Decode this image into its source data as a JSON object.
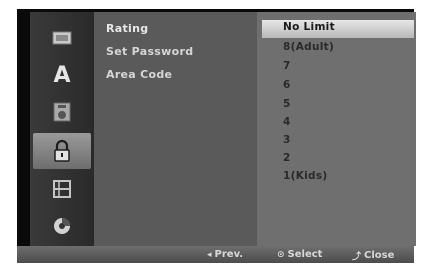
{
  "sidebar": {
    "icons": [
      {
        "name": "disc-icon",
        "glyph": "▭"
      },
      {
        "name": "language-icon",
        "glyph": "A"
      },
      {
        "name": "audio-icon",
        "glyph": "♫"
      },
      {
        "name": "lock-icon",
        "glyph": "🔒"
      },
      {
        "name": "film-icon",
        "glyph": "▦"
      },
      {
        "name": "other-icon",
        "glyph": "●"
      }
    ]
  },
  "menu": {
    "items": [
      "Rating",
      "Set Password",
      "Area Code"
    ]
  },
  "options": {
    "items": [
      "No Limit",
      "8(Adult)",
      "7",
      "6",
      "5",
      "4",
      "3",
      "2",
      "1(Kids)"
    ],
    "selected": "No Limit"
  },
  "footer": {
    "prev_icon": "◂",
    "prev_label": "Prev.",
    "select_icon": "⊙",
    "select_label": "Select",
    "close_icon": "⤴",
    "close_label": "Close"
  },
  "colors": {
    "selected_bg": "#d8d8d8",
    "panel_bg": "#6f6f6f",
    "menu_bg": "#5a5a5a"
  }
}
